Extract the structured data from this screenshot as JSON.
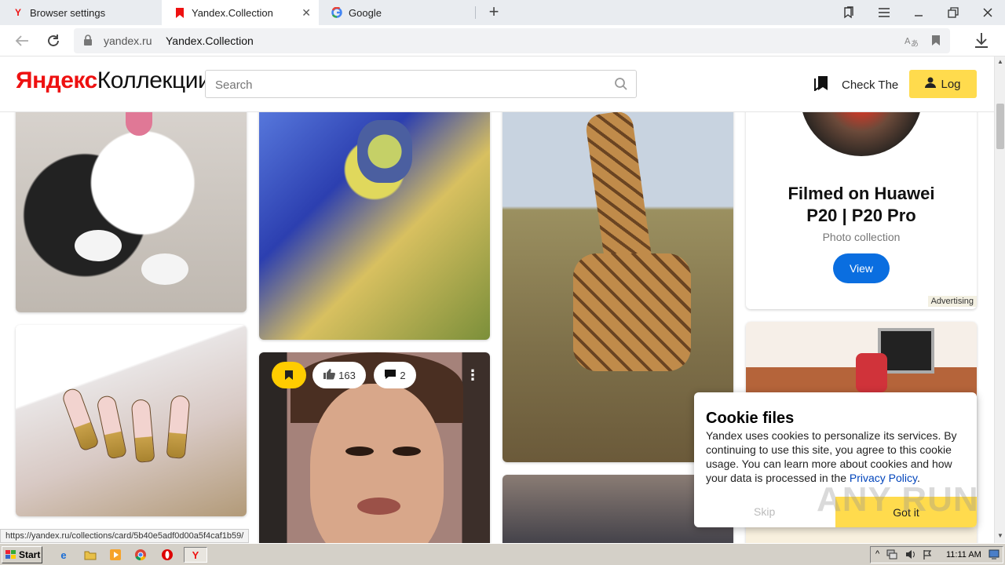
{
  "browser": {
    "tabs": [
      {
        "title": "Browser settings"
      },
      {
        "title": "Yandex.Collection"
      },
      {
        "title": "Google"
      }
    ],
    "new_tab_label": "+",
    "address": {
      "domain": "yandex.ru",
      "page_title": "Yandex.Collection"
    }
  },
  "site": {
    "logo_yandex": "Яндекс",
    "logo_collections": "Коллекции",
    "search_placeholder": "Search",
    "check_label": "Check The",
    "login_label": "Log"
  },
  "cards": {
    "likes": "163",
    "comments": "2"
  },
  "ad": {
    "title_line1": "Filmed on Huawei",
    "title_line2": "P20 | P20 Pro",
    "subtitle": "Photo collection",
    "button": "View",
    "label": "Advertising"
  },
  "cookie": {
    "title": "Cookie files",
    "text": "Yandex uses cookies to personalize its services. By continuing to use this site, you agree to this cookie usage. You can learn more about cookies and how your data is processed in the ",
    "link": "Privacy Policy",
    "text_end": ".",
    "skip": "Skip",
    "accept": "Got it"
  },
  "status_url": "https://yandex.ru/collections/card/5b40e5adf0d00a5f4caf1b59/",
  "watermark": "ANY RUN",
  "taskbar": {
    "start": "Start",
    "clock": "11:11 AM"
  }
}
